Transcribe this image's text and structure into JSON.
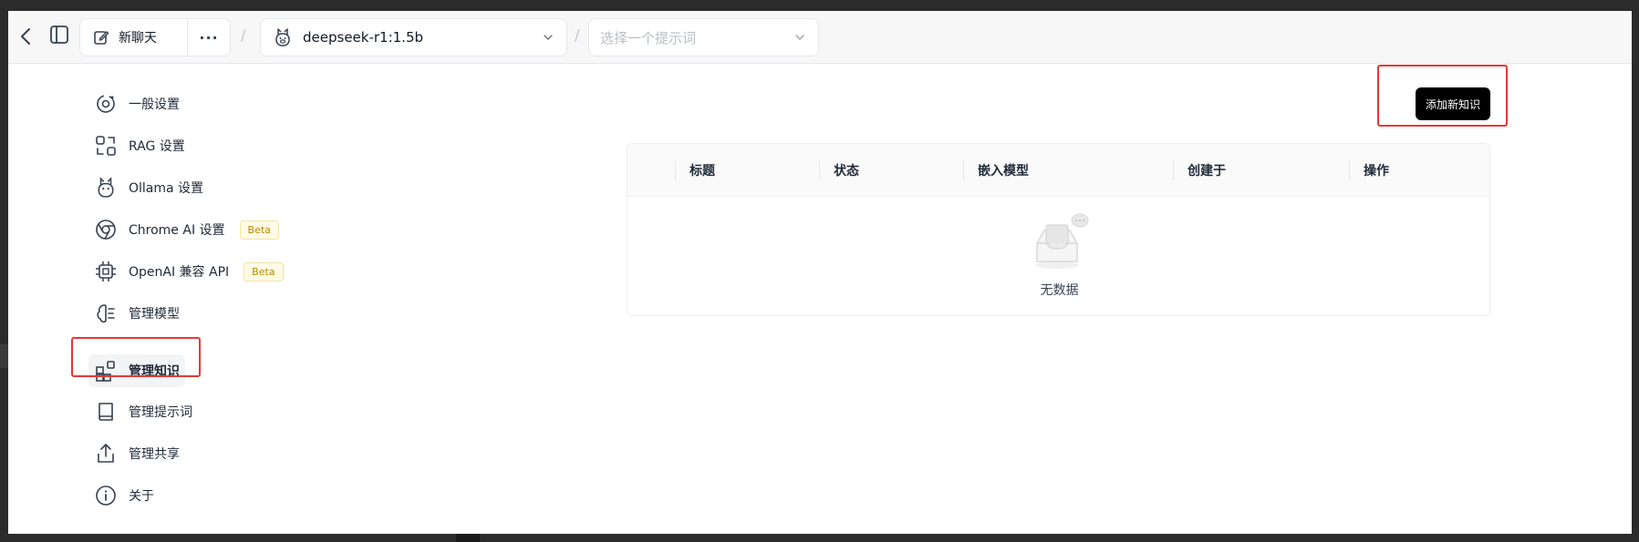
{
  "topbar": {
    "new_chat_label": "新聊天",
    "more_label": "···",
    "separator": "/",
    "model_value": "deepseek-r1:1.5b",
    "prompt_placeholder": "选择一个提示词"
  },
  "sidebar": {
    "items": [
      {
        "label": "一般设置",
        "icon": "gear-icon"
      },
      {
        "label": "RAG 设置",
        "icon": "rag-icon"
      },
      {
        "label": "Ollama 设置",
        "icon": "ollama-icon"
      },
      {
        "label": "Chrome AI 设置",
        "icon": "chrome-icon",
        "badge": "Beta"
      },
      {
        "label": "OpenAI 兼容 API",
        "icon": "chip-icon",
        "badge": "Beta"
      },
      {
        "label": "管理模型",
        "icon": "brain-icon"
      },
      {
        "label": "管理知识",
        "icon": "blocks-icon",
        "active": true
      },
      {
        "label": "管理提示词",
        "icon": "book-icon"
      },
      {
        "label": "管理共享",
        "icon": "share-icon"
      },
      {
        "label": "关于",
        "icon": "info-icon"
      }
    ]
  },
  "main": {
    "add_button_label": "添加新知识",
    "table": {
      "columns": [
        "标题",
        "状态",
        "嵌入模型",
        "创建于",
        "操作"
      ],
      "rows": [],
      "empty_text": "无数据"
    }
  },
  "colors": {
    "highlight": "#e53935",
    "primary_button": "#000000",
    "beta_text": "#b58a00",
    "beta_bg": "#fffbe6"
  }
}
